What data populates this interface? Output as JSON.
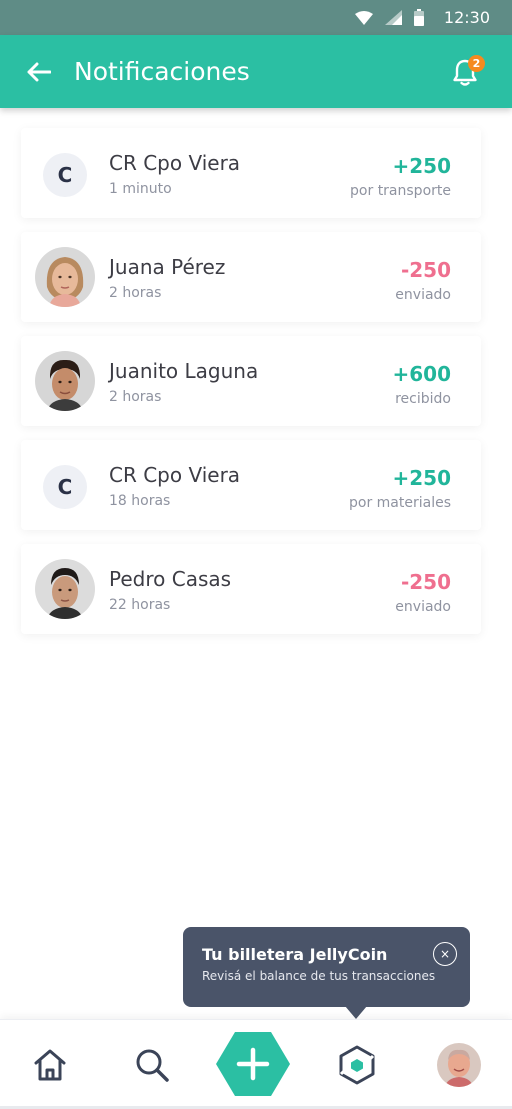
{
  "status_bar": {
    "time": "12:30"
  },
  "header": {
    "title": "Notificaciones",
    "badge_count": "2"
  },
  "notifications": [
    {
      "name": "CR Cpo Viera",
      "time": "1 minuto",
      "amount": "+250",
      "description": "por transporte",
      "avatar_letter": "C",
      "avatar_type": "letter",
      "sign": "pos"
    },
    {
      "name": "Juana Pérez",
      "time": "2 horas",
      "amount": "-250",
      "description": "enviado",
      "avatar_type": "photo-woman",
      "sign": "neg"
    },
    {
      "name": "Juanito Laguna",
      "time": "2 horas",
      "amount": "+600",
      "description": "recibido",
      "avatar_type": "photo-man-1",
      "sign": "pos"
    },
    {
      "name": "CR Cpo Viera",
      "time": "18 horas",
      "amount": "+250",
      "description": "por materiales",
      "avatar_letter": "C",
      "avatar_type": "letter",
      "sign": "pos"
    },
    {
      "name": "Pedro Casas",
      "time": "22 horas",
      "amount": "-250",
      "description": "enviado",
      "avatar_type": "photo-man-2",
      "sign": "neg"
    }
  ],
  "tooltip": {
    "title": "Tu billetera JellyCoin",
    "text": "Revisá el balance de tus transacciones",
    "close_icon": "×"
  },
  "bottom_nav": {
    "items": [
      "home-icon",
      "search-icon",
      "add-icon",
      "wallet-icon",
      "profile-avatar"
    ]
  },
  "colors": {
    "primary": "#2bbfa3",
    "positive": "#21b59a",
    "negative": "#ef6f8f",
    "tooltip_bg": "#4a5469"
  }
}
